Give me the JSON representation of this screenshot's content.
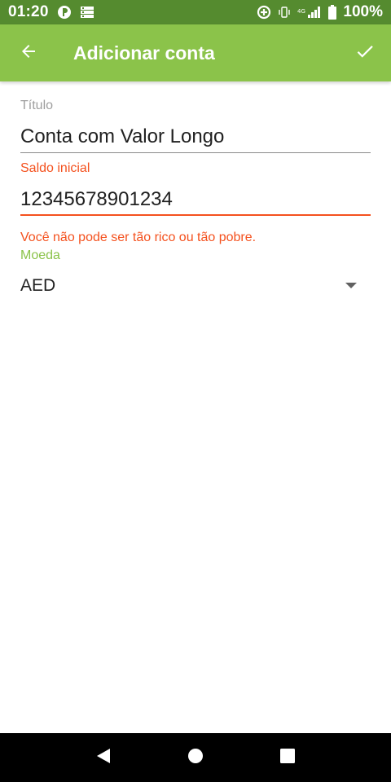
{
  "status_bar": {
    "time": "01:20",
    "battery": "100%",
    "icons": [
      "notification-icon",
      "storage-icon",
      "data-saver-icon",
      "vibrate-icon",
      "signal-4g-icon",
      "battery-icon"
    ]
  },
  "app_bar": {
    "title": "Adicionar conta",
    "back_icon": "arrow-back-icon",
    "confirm_icon": "check-icon",
    "color": "#8bc34a"
  },
  "form": {
    "titulo": {
      "label": "Título",
      "value": "Conta com Valor Longo"
    },
    "saldo_inicial": {
      "label": "Saldo inicial",
      "value": "12345678901234",
      "error": "Você não pode ser tão rico ou tão pobre.",
      "error_color": "#f4511e"
    },
    "moeda": {
      "label": "Moeda",
      "selected": "AED"
    }
  },
  "nav_bar": {
    "buttons": [
      "back-nav-icon",
      "home-nav-icon",
      "recents-nav-icon"
    ]
  }
}
